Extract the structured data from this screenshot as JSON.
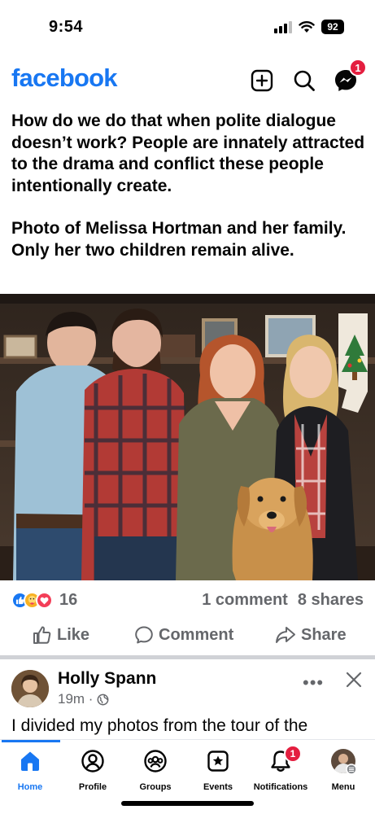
{
  "status_bar": {
    "time": "9:54",
    "battery": "92",
    "icons": [
      "cellular-signal-icon",
      "wifi-icon",
      "battery-icon"
    ]
  },
  "header": {
    "logo": "facebook",
    "brand_color": "#1877f2",
    "icons": [
      "create-plus-icon",
      "search-icon",
      "messenger-icon"
    ],
    "messenger_badge": "1"
  },
  "post": {
    "text_paragraphs": [
      "How do we do that when polite dialogue doesn’t work? People are innately attracted to the drama and conflict these people intentionally create.",
      "Photo of Melissa Hortman and her family. Only her two children remain alive."
    ],
    "photo_icon": "family-photo",
    "reaction_icons": [
      "like-reaction-icon",
      "care-reaction-icon",
      "love-reaction-icon"
    ],
    "reaction_count": "16",
    "comments": "1 comment",
    "shares": "8 shares",
    "actions": {
      "like": "Like",
      "comment": "Comment",
      "share": "Share"
    }
  },
  "next_post": {
    "author": "Holly Spann",
    "time": "19m ·",
    "privacy_icon": "globe-icon",
    "more": "•••",
    "text": "I divided my photos from the tour of the"
  },
  "tabbar": {
    "tabs": [
      {
        "label": "Home",
        "icon": "home-icon",
        "active": true
      },
      {
        "label": "Profile",
        "icon": "profile-icon"
      },
      {
        "label": "Groups",
        "icon": "groups-icon"
      },
      {
        "label": "Events",
        "icon": "events-icon"
      },
      {
        "label": "Notifications",
        "icon": "bell-icon",
        "badge": "1"
      },
      {
        "label": "Menu",
        "icon": "menu-avatar-icon"
      }
    ]
  },
  "colors": {
    "accent": "#1877f2",
    "badge": "#e41e3f",
    "secondary_text": "#65676b"
  }
}
